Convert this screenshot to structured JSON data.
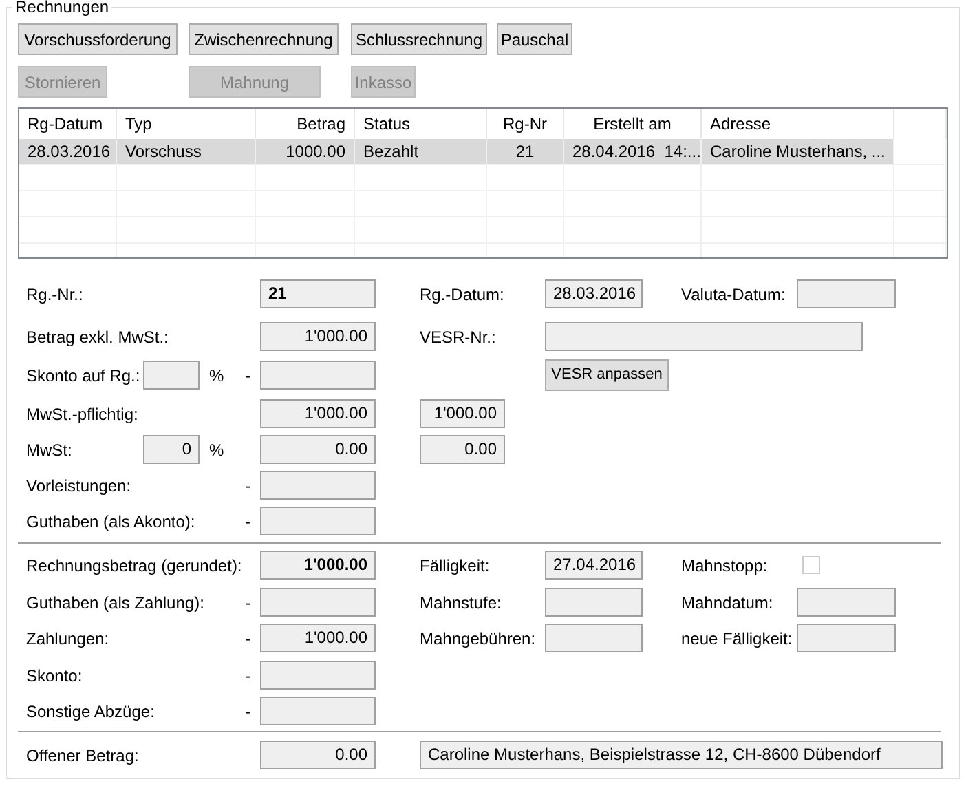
{
  "group": {
    "title": "Rechnungen"
  },
  "primary_buttons": [
    {
      "label": "Vorschussforderung",
      "disabled": false
    },
    {
      "label": "Zwischenrechnung",
      "disabled": false
    },
    {
      "label": "Schlussrechnung",
      "disabled": false
    },
    {
      "label": "Pauschal",
      "disabled": false
    }
  ],
  "secondary_buttons": [
    {
      "label": "Stornieren",
      "disabled": true
    },
    {
      "label": "Mahnung",
      "disabled": true
    },
    {
      "label": "Inkasso",
      "disabled": true
    }
  ],
  "table": {
    "columns": [
      "Rg-Datum",
      "Typ",
      "Betrag",
      "Status",
      "Rg-Nr",
      "Erstellt am",
      "Adresse"
    ],
    "rows": [
      {
        "selected": true,
        "cells": [
          "28.03.2016",
          "Vorschuss",
          "1000.00",
          "Bezahlt",
          "21",
          "28.04.2016  14:...",
          "Caroline Musterhans, ..."
        ]
      }
    ]
  },
  "detail_rows": [
    {
      "left": {
        "kind": "text",
        "label": "Rg.-Nr.:",
        "value": "21",
        "emphasized": true
      },
      "middle": {
        "kind": "labeled_field",
        "label": "Rg.-Datum:",
        "value": "28.03.2016"
      },
      "right": {
        "kind": "labeled_field",
        "label": "Valuta-Datum:"
      }
    },
    {
      "left": {
        "kind": "amount",
        "label": "Betrag exkl. MwSt.:",
        "value": "1'000.00",
        "emphasized": false
      },
      "middle": {
        "kind": "labeled_wide_field",
        "label": "VESR-Nr.:"
      }
    },
    {
      "left": {
        "kind": "amount",
        "label": "Skonto auf Rg.:",
        "unit": "%",
        "sign": "-"
      },
      "middle": {
        "kind": "button",
        "label": "VESR anpassen"
      }
    },
    {
      "left": {
        "kind": "amount",
        "label": "MwSt.-pflichtig:",
        "value": "1'000.00",
        "emphasized": false
      },
      "middle": {
        "kind": "field",
        "value": "1'000.00"
      }
    },
    {
      "left": {
        "kind": "amount",
        "label": "MwSt:",
        "small_value": "0",
        "unit": "%",
        "value": "0.00",
        "emphasized": false
      },
      "middle": {
        "kind": "field",
        "value": "0.00"
      }
    },
    {
      "left": {
        "kind": "amount",
        "label": "Vorleistungen:",
        "sign": "-"
      }
    },
    {
      "left": {
        "kind": "amount",
        "label": "Guthaben (als Akonto):",
        "sign": "-"
      }
    }
  ],
  "total_rows": [
    {
      "left": {
        "kind": "amount",
        "label": "Rechnungsbetrag (gerundet):",
        "value": "1'000.00",
        "emphasized": true
      },
      "middle": {
        "kind": "labeled_field",
        "label": "Fälligkeit:",
        "value": "27.04.2016"
      },
      "right": {
        "kind": "labeled_checkbox",
        "label": "Mahnstopp:",
        "checked": false
      }
    },
    {
      "left": {
        "kind": "amount",
        "label": "Guthaben (als Zahlung):",
        "sign": "-"
      },
      "middle": {
        "kind": "labeled_field",
        "label": "Mahnstufe:"
      },
      "right": {
        "kind": "labeled_field",
        "label": "Mahndatum:"
      }
    },
    {
      "left": {
        "kind": "amount",
        "label": "Zahlungen:",
        "sign": "-",
        "value": "1'000.00",
        "emphasized": false
      },
      "middle": {
        "kind": "labeled_field",
        "label": "Mahngebühren:"
      },
      "right": {
        "kind": "labeled_field",
        "label": "neue Fälligkeit:"
      }
    },
    {
      "left": {
        "kind": "amount",
        "label": "Skonto:",
        "sign": "-"
      }
    },
    {
      "left": {
        "kind": "amount",
        "label": "Sonstige Abzüge:",
        "sign": "-"
      }
    }
  ],
  "balance_row": {
    "left": {
      "kind": "amount",
      "label": "Offener Betrag:",
      "value": "0.00",
      "emphasized": false
    },
    "middle": {
      "kind": "address_field",
      "value": "Caroline Musterhans, Beispielstrasse 12, CH-8600 Dübendorf"
    }
  }
}
